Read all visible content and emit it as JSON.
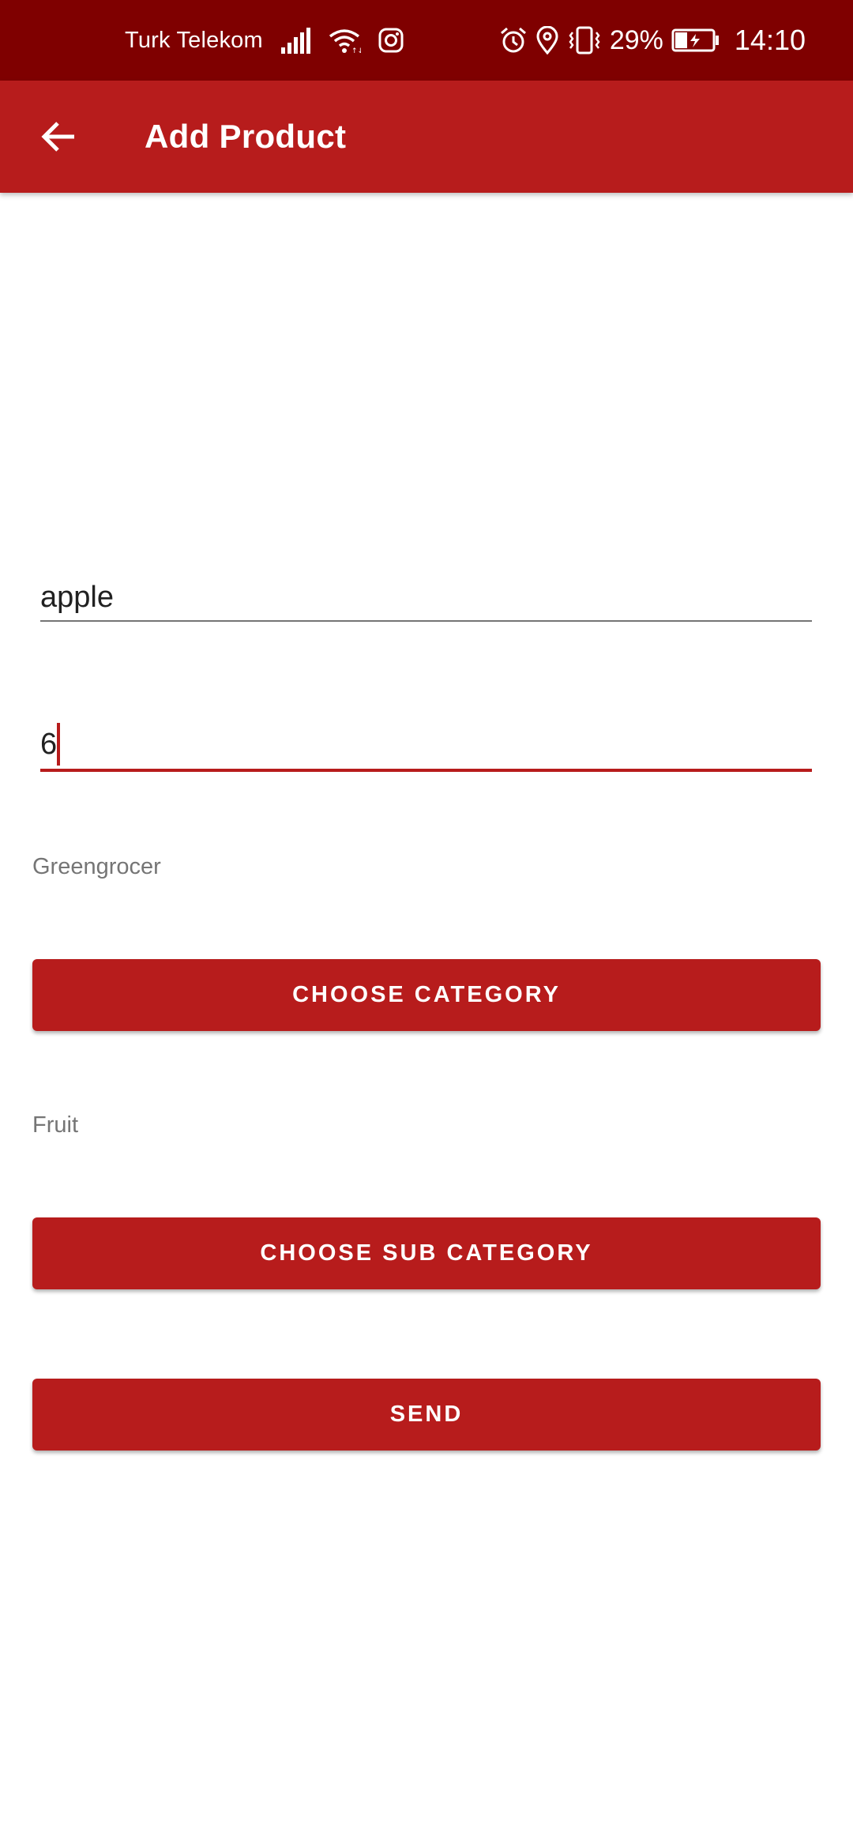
{
  "status_bar": {
    "carrier": "Turk Telekom",
    "battery_percent": "29%",
    "time": "14:10",
    "icons": [
      "signal-icon",
      "wifi-icon",
      "instagram-icon",
      "alarm-icon",
      "location-icon",
      "vibrate-icon",
      "battery-charging-icon"
    ]
  },
  "app_bar": {
    "title": "Add Product",
    "back_icon": "arrow-left-icon"
  },
  "form": {
    "product_name_value": "apple",
    "quantity_value": "6",
    "category_selected": "Greengrocer",
    "choose_category_label": "CHOOSE CATEGORY",
    "sub_category_selected": "Fruit",
    "choose_sub_category_label": "CHOOSE SUB CATEGORY",
    "send_label": "SEND"
  },
  "colors": {
    "status_bar": "#7f0000",
    "primary": "#b71c1c",
    "background": "#ffffff",
    "secondary_text": "#757575"
  }
}
